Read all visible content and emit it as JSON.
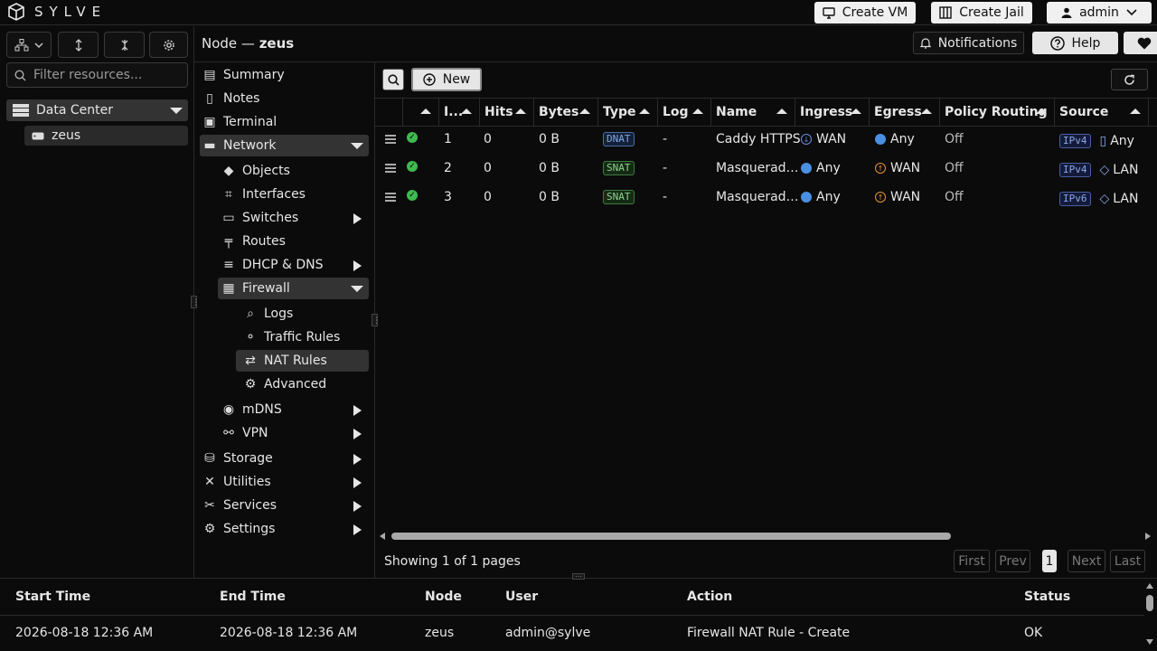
{
  "app": {
    "name": "SYLVE"
  },
  "topbar": {
    "create_vm": "Create VM",
    "create_jail": "Create Jail",
    "user": "admin"
  },
  "left": {
    "filter_placeholder": "Filter resources...",
    "tree_root": "Data Center",
    "tree_node": "zeus"
  },
  "header": {
    "prefix": "Node —",
    "node": "zeus",
    "notifications": "Notifications",
    "help": "Help"
  },
  "nav": {
    "summary": "Summary",
    "notes": "Notes",
    "terminal": "Terminal",
    "network": "Network",
    "objects": "Objects",
    "interfaces": "Interfaces",
    "switches": "Switches",
    "routes": "Routes",
    "dhcp": "DHCP & DNS",
    "firewall": "Firewall",
    "logs": "Logs",
    "traffic_rules": "Traffic Rules",
    "nat_rules": "NAT Rules",
    "advanced": "Advanced",
    "mdns": "mDNS",
    "vpn": "VPN",
    "storage": "Storage",
    "utilities": "Utilities",
    "services": "Services",
    "settings": "Settings"
  },
  "toolbar": {
    "new": "New"
  },
  "table": {
    "headers": [
      "I...",
      "Hits",
      "Bytes",
      "Type",
      "Log",
      "Name",
      "Ingress",
      "Egress",
      "Policy Routing",
      "Source"
    ],
    "rows": [
      {
        "id": "1",
        "hits": "0",
        "bytes": "0 B",
        "type": "DNAT",
        "log": "-",
        "name": "Caddy HTTPS",
        "ingress": "WAN",
        "egress": "Any",
        "policy": "Off",
        "src_ver": "IPv4",
        "src": "Any"
      },
      {
        "id": "2",
        "hits": "0",
        "bytes": "0 B",
        "type": "SNAT",
        "log": "-",
        "name": "Masquerad…",
        "ingress": "Any",
        "egress": "WAN",
        "policy": "Off",
        "src_ver": "IPv4",
        "src": "LAN"
      },
      {
        "id": "3",
        "hits": "0",
        "bytes": "0 B",
        "type": "SNAT",
        "log": "-",
        "name": "Masquerad…",
        "ingress": "Any",
        "egress": "WAN",
        "policy": "Off",
        "src_ver": "IPv6",
        "src": "LAN"
      }
    ]
  },
  "pagination": {
    "status": "Showing 1 of 1 pages",
    "first": "First",
    "prev": "Prev",
    "page": "1",
    "next": "Next",
    "last": "Last"
  },
  "tasks": {
    "headers": [
      "Start Time",
      "End Time",
      "Node",
      "User",
      "Action",
      "Status"
    ],
    "row": {
      "start": "2026-08-18 12:36 AM",
      "end": "2026-08-18 12:36 AM",
      "node": "zeus",
      "user": "admin@sylve",
      "action": "Firewall NAT Rule - Create",
      "status": "OK"
    }
  },
  "colors": {
    "accent": "#e6e6e6",
    "ok": "#3fb950",
    "wan_out": "#e8923a",
    "globe": "#4a90e2"
  }
}
